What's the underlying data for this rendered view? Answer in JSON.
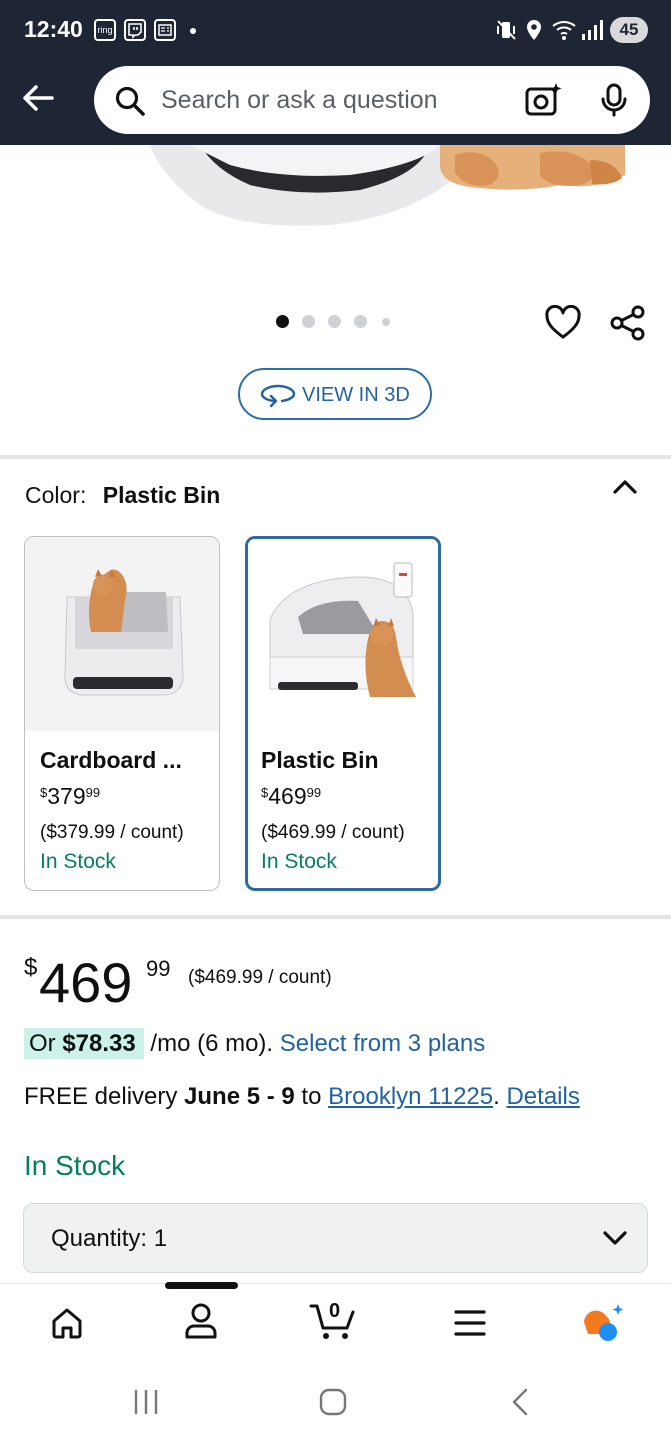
{
  "status_bar": {
    "time": "12:40",
    "ring_icon_label": "ring",
    "battery": "45"
  },
  "search": {
    "placeholder": "Search or ask a question"
  },
  "carousel": {
    "pages": 5,
    "active_index": 0
  },
  "view_3d_label": "VIEW IN 3D",
  "color": {
    "label": "Color:",
    "selected": "Plastic Bin"
  },
  "variants": [
    {
      "name": "Cardboard ...",
      "price_currency": "$",
      "price_whole": "379",
      "price_fraction": "99",
      "unit_price": "($379.99 / count)",
      "stock": "In Stock",
      "selected": false
    },
    {
      "name": "Plastic Bin",
      "price_currency": "$",
      "price_whole": "469",
      "price_fraction": "99",
      "unit_price": "($469.99 / count)",
      "stock": "In Stock",
      "selected": true
    }
  ],
  "price": {
    "currency": "$",
    "whole": "469",
    "fraction": "99",
    "per_count": "($469.99 / count)"
  },
  "monthly": {
    "prefix": "Or ",
    "amount": "$78.33",
    "term": " /mo (6 mo). ",
    "link": "Select from 3 plans"
  },
  "delivery": {
    "prefix": "FREE delivery ",
    "dates": "June 5 - 9",
    "to": " to ",
    "location": "Brooklyn 11225",
    "separator": ". ",
    "details": "Details"
  },
  "availability": "In Stock",
  "quantity": {
    "label": "Quantity: 1"
  },
  "bottom_nav": {
    "items": [
      "home-icon",
      "account-icon",
      "cart-icon",
      "menu-icon",
      "rufus-icon"
    ],
    "cart_count": "0"
  },
  "colors": {
    "header_bg": "#1e2535",
    "link": "#2162a1",
    "in_stock": "#067d62",
    "selected_border": "#2c6aa3",
    "monthly_highlight": "#ccf1e8"
  }
}
